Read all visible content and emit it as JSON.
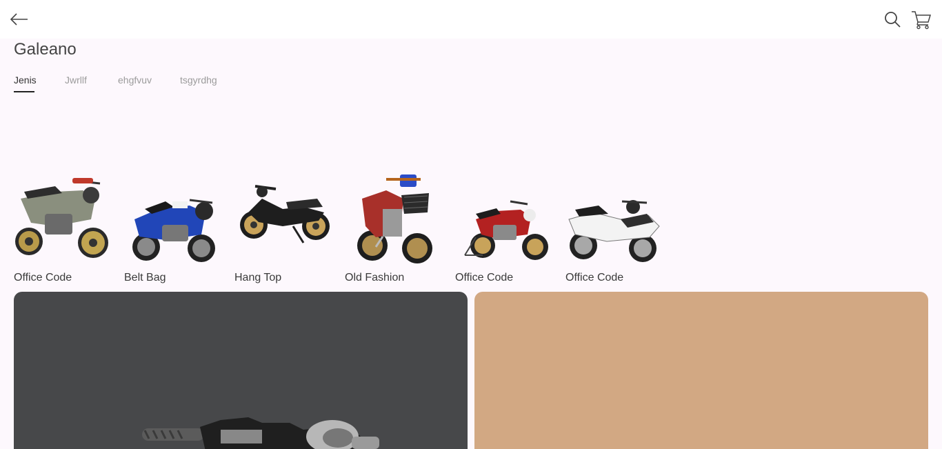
{
  "header": {
    "back_icon": "arrow-left-icon",
    "search_icon": "search-icon",
    "cart_icon": "cart-icon"
  },
  "store": {
    "title": "Galeano"
  },
  "tabs": [
    {
      "label": "Jenis",
      "active": true
    },
    {
      "label": "Jwrllf",
      "active": false
    },
    {
      "label": "ehgfvuv",
      "active": false
    },
    {
      "label": "tsgyrdhg",
      "active": false
    }
  ],
  "categories": [
    {
      "label": "Office Code",
      "image": "motorcycle-olive-sport"
    },
    {
      "label": "Belt Bag",
      "image": "motorcycle-blue-sport"
    },
    {
      "label": "Hang Top",
      "image": "motorcycle-black-scooter"
    },
    {
      "label": "Old Fashion",
      "image": "motorcycle-red-basket"
    },
    {
      "label": "Office Code",
      "image": "motorcycle-red-classic"
    },
    {
      "label": "Office Code",
      "image": "motorcycle-white-scooter"
    }
  ],
  "banners": [
    {
      "background": "#47484a",
      "image": "motorcycle-handlebar-closeup"
    },
    {
      "background": "#d2a883"
    }
  ],
  "colors": {
    "page_background": "#fdf8fd",
    "header_background": "#ffffff",
    "text_primary": "#444444",
    "tab_inactive": "#9b9b9b"
  }
}
